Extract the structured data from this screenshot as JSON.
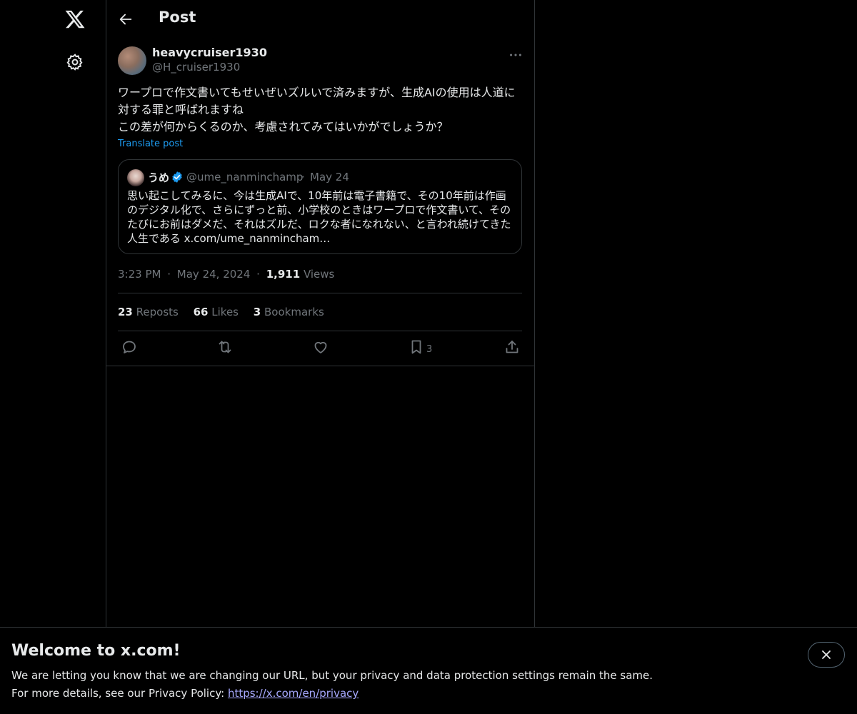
{
  "nav": {
    "logo_icon": "x-logo-icon",
    "settings_icon": "gear-icon"
  },
  "header": {
    "title": "Post",
    "back_icon": "arrow-left-icon"
  },
  "post": {
    "author_name": "heavycruiser1930",
    "author_handle": "@H_cruiser1930",
    "text": "ワープロで作文書いてもせいぜいズルいで済みますが、生成AIの使用は人道に対する罪と呼ばれますね\nこの差が何からくるのか、考慮されてみてはいかがでしょうか？",
    "translate_label": "Translate post",
    "quote": {
      "name": "うめ",
      "handle": "@ume_nanminchamp",
      "separator": "·",
      "date": "May 24",
      "text": "思い起こしてみるに、今は生成AIで、10年前は電子書籍で、その10年前は作画のデジタル化で、さらにずっと前、小学校のときはワープロで作文書いて、そのたびにお前はダメだ、それはズルだ、ロクな者になれない、と言われ続けてきた人生である x.com/ume_nanmincham…"
    },
    "time": "3:23 PM",
    "date": "May 24, 2024",
    "separator": "·",
    "views_count": "1,911",
    "views_label": "Views",
    "stats": {
      "reposts_count": "23",
      "reposts_label": "Reposts",
      "likes_count": "66",
      "likes_label": "Likes",
      "bookmarks_count": "3",
      "bookmarks_label": "Bookmarks"
    },
    "actions": {
      "bookmark_count": "3"
    }
  },
  "banner": {
    "title": "Welcome to x.com!",
    "line1": "We are letting you know that we are changing our URL, but your privacy and data protection settings remain the same.",
    "line2_prefix": "For more details, see our Privacy Policy: ",
    "link": "https://x.com/en/privacy"
  },
  "colors": {
    "background": "#000000",
    "text": "#e7e9ea",
    "muted": "#71767b",
    "accent": "#1d9bf0",
    "border": "#2f3336",
    "link": "#a7a9ff"
  }
}
